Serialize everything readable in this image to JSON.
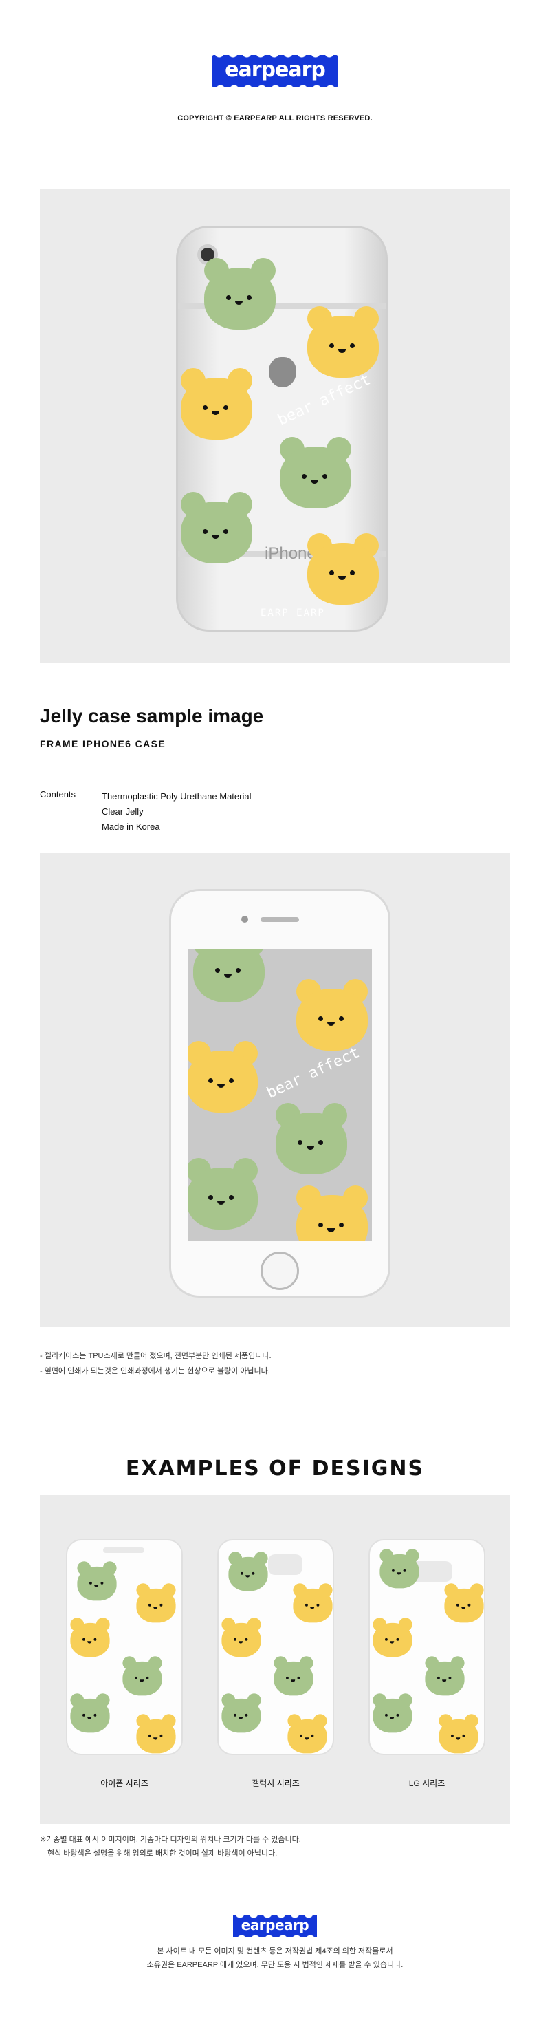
{
  "header": {
    "logo_text": "earpearp",
    "copyright": "COPYRIGHT © EARPEARP ALL RIGHTS RESERVED."
  },
  "sample": {
    "title": "Jelly case sample image",
    "subtitle": "FRAME IPHONE6 CASE",
    "contents_label": "Contents",
    "contents": [
      "Thermoplastic Poly Urethane Material",
      "Clear Jelly",
      "Made in Korea"
    ],
    "back_phone_text": "iPhone",
    "case_brand": "EARP EARP",
    "graffiti": "bear affect",
    "notes": [
      "- 젤리케이스는 TPU소재로 만들어 졌으며, 전면부분만 인쇄된 제품입니다.",
      "- 옆면에 인쇄가 되는것은 인쇄과정에서 생기는 현상으로 불량이 아닙니다."
    ]
  },
  "examples": {
    "title": "EXAMPLES OF DESIGNS",
    "labels": [
      "아이폰 시리즈",
      "갤럭시 시리즈",
      "LG 시리즈"
    ],
    "notes": [
      "※기종별 대표 예시 이미지이며, 기종마다 디자인의 위치나 크기가 다를 수 있습니다.",
      "　현식 바탕색은 설명을 위해 임의로 배치한 것이며 실제 바탕색이 아닙니다."
    ]
  },
  "footer": {
    "logo_text": "earpearp",
    "lines": [
      "본 사이트 내 모든 이미지 및 컨텐츠 등은 저작권법 제4조의 의한 저작물로서",
      "소유권은 EARPEARP 에게 있으며, 무단 도용 시 법적인 제재를 받을 수 있습니다."
    ]
  },
  "colors": {
    "brand": "#1437d8",
    "bear_green": "#a7c58c",
    "bear_yellow": "#f7cf58",
    "panel": "#ebebeb"
  }
}
